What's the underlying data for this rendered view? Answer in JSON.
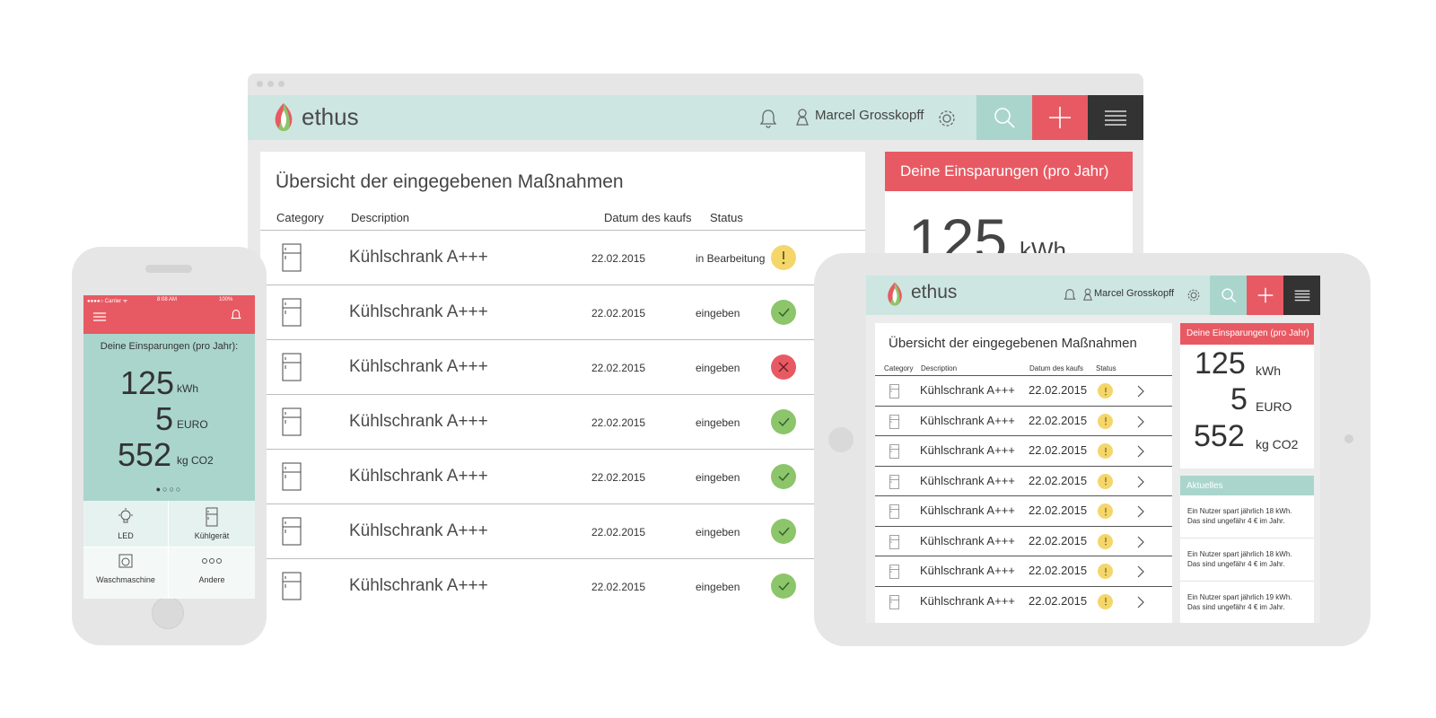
{
  "brand": {
    "name": "ethus"
  },
  "colors": {
    "accent_red": "#e85a63",
    "teal": "#cde6e1",
    "teal_dark": "#a9d5cd",
    "dark": "#333333",
    "ok": "#8cc56a",
    "warn": "#f5d66b"
  },
  "header": {
    "user": "Marcel Grosskopff",
    "icons": [
      "bell-icon",
      "user-icon",
      "gear-icon",
      "search-icon",
      "plus-icon",
      "menu-icon"
    ]
  },
  "table": {
    "title": "Übersicht der eingegebenen Maßnahmen",
    "columns": [
      "Category",
      "Description",
      "Datum des kaufs",
      "Status"
    ],
    "rows": [
      {
        "desc": "Kühlschrank A+++",
        "date": "22.02.2015",
        "status": "in Bearbeitung",
        "state": "warn"
      },
      {
        "desc": "Kühlschrank A+++",
        "date": "22.02.2015",
        "status": "eingeben",
        "state": "ok"
      },
      {
        "desc": "Kühlschrank A+++",
        "date": "22.02.2015",
        "status": "eingeben",
        "state": "error"
      },
      {
        "desc": "Kühlschrank A+++",
        "date": "22.02.2015",
        "status": "eingeben",
        "state": "ok"
      },
      {
        "desc": "Kühlschrank A+++",
        "date": "22.02.2015",
        "status": "eingeben",
        "state": "ok"
      },
      {
        "desc": "Kühlschrank A+++",
        "date": "22.02.2015",
        "status": "eingeben",
        "state": "ok"
      },
      {
        "desc": "Kühlschrank A+++",
        "date": "22.02.2015",
        "status": "eingeben",
        "state": "ok"
      }
    ]
  },
  "savings": {
    "title": "Deine Einsparungen (pro Jahr)",
    "kwh_value": "125",
    "kwh_unit": "kWh",
    "euro_value": "5",
    "euro_unit": "EURO",
    "co2_value": "552",
    "co2_unit": "kg CO2"
  },
  "phone": {
    "status": {
      "carrier": "●●●●○ Carrier ᯤ",
      "time": "8:08 AM",
      "battery": "100%"
    },
    "title": "Deine Einsparungen (pro Jahr):",
    "page_dots": "●○○○",
    "categories": [
      {
        "label": "LED",
        "icon": "lightbulb-icon"
      },
      {
        "label": "Kühlgerät",
        "icon": "fridge-icon"
      },
      {
        "label": "Waschmaschine",
        "icon": "washing-machine-icon"
      },
      {
        "label": "Andere",
        "icon": "more-icon"
      }
    ]
  },
  "tablet": {
    "rows": [
      {
        "desc": "Kühlschrank A+++",
        "date": "22.02.2015"
      },
      {
        "desc": "Kühlschrank A+++",
        "date": "22.02.2015"
      },
      {
        "desc": "Kühlschrank A+++",
        "date": "22.02.2015"
      },
      {
        "desc": "Kühlschrank A+++",
        "date": "22.02.2015"
      },
      {
        "desc": "Kühlschrank A+++",
        "date": "22.02.2015"
      },
      {
        "desc": "Kühlschrank A+++",
        "date": "22.02.2015"
      },
      {
        "desc": "Kühlschrank A+++",
        "date": "22.02.2015"
      },
      {
        "desc": "Kühlschrank A+++",
        "date": "22.02.2015"
      }
    ],
    "news_title": "Aktuelles",
    "news": [
      {
        "line1": "Ein Nutzer spart jährlich 18 kWh.",
        "line2": "Das sind ungefähr 4 € im Jahr."
      },
      {
        "line1": "Ein Nutzer spart jährlich 18 kWh.",
        "line2": "Das sind ungefähr 4 € im Jahr."
      },
      {
        "line1": "Ein Nutzer spart jährlich 19 kWh.",
        "line2": "Das sind ungefähr 4 € im Jahr."
      }
    ]
  }
}
